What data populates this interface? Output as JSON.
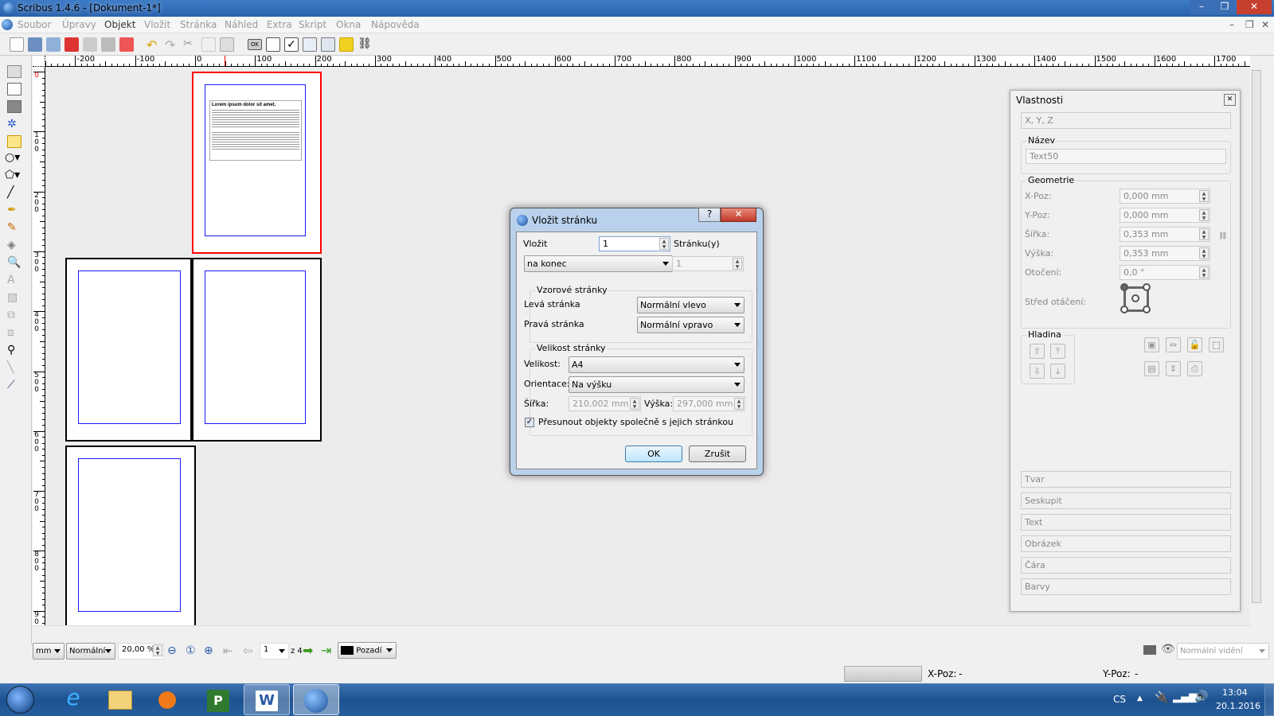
{
  "window": {
    "title": "Scribus 1.4.6 - [Dokument-1*]",
    "controls": [
      "–",
      "❐",
      "✕"
    ],
    "mdi_controls": [
      "–",
      "❐",
      "✕"
    ]
  },
  "menu": [
    "Soubor",
    "Úpravy",
    "Objekt",
    "Vložit",
    "Stránka",
    "Náhled",
    "Extra",
    "Skript",
    "Okna",
    "Nápověda"
  ],
  "toolbar": {
    "icons": [
      "new-document-icon",
      "open-icon",
      "save-icon",
      "close-icon",
      "print-icon",
      "preflight-icon",
      "pdf-export-icon",
      "undo-icon",
      "redo-icon",
      "cut-icon",
      "copy-icon",
      "paste-icon",
      "pdf-button-icon",
      "pdf-text-field-icon",
      "pdf-checkbox-icon",
      "pdf-combobox-icon",
      "pdf-listbox-icon",
      "pdf-annotation-icon",
      "pdf-link-icon"
    ],
    "ok_label": "OK"
  },
  "rulers": {
    "horizontal": [
      "-200",
      "-100",
      "0",
      "100",
      "200",
      "300",
      "400",
      "500",
      "600",
      "700",
      "800",
      "900",
      "1000",
      "1100",
      "1200",
      "1300",
      "1400",
      "1500",
      "1600",
      "1700"
    ],
    "vertical": [
      "0",
      "100",
      "200",
      "300",
      "400",
      "500",
      "600",
      "700",
      "800",
      "900"
    ]
  },
  "page1_text": {
    "heading": "Lorem ipsum dolor sit amet."
  },
  "dialog": {
    "title": "Vložit stránku",
    "help": "?",
    "close": "✕",
    "insert_label": "Vložit",
    "insert_count": "1",
    "pages_label": "Stránku(y)",
    "position": "na konec",
    "position_page": "1",
    "master_group": "Vzorové stránky",
    "left_label": "Levá stránka",
    "left_value": "Normální vlevo",
    "right_label": "Pravá stránka",
    "right_value": "Normální vpravo",
    "size_group": "Velikost stránky",
    "size_label": "Velikost:",
    "size_value": "A4",
    "orient_label": "Orientace:",
    "orient_value": "Na výšku",
    "width_label": "Šířka:",
    "width_value": "210,002 mm",
    "height_label": "Výška:",
    "height_value": "297,000 mm",
    "move_objects_label": "Přesunout objekty společně s jejich stránkou",
    "move_objects_checked": true,
    "ok": "OK",
    "cancel": "Zrušit"
  },
  "properties": {
    "title": "Vlastnosti",
    "xyz": "X, Y, Z",
    "name_group": "Název",
    "name_value": "Text50",
    "geometry_group": "Geometrie",
    "fields": [
      {
        "label": "X-Poz:",
        "value": "0,000 mm"
      },
      {
        "label": "Y-Poz:",
        "value": "0,000 mm"
      },
      {
        "label": "Šířka:",
        "value": "0,353 mm"
      },
      {
        "label": "Výška:",
        "value": "0,353 mm"
      },
      {
        "label": "Otočení:",
        "value": "0,0 °"
      }
    ],
    "rotation_center_label": "Střed otáčení:",
    "layer_group": "Hladina",
    "sections": [
      "Tvar",
      "Seskupit",
      "Text",
      "Obrázek",
      "Čára",
      "Barvy"
    ]
  },
  "statusbar": {
    "unit": "mm",
    "mode": "Normální",
    "zoom": "20,00 %",
    "page": "1",
    "page_of": "z 4",
    "layer": "Pozadí",
    "view_mode": "Normální vidění",
    "xpos_label": "X-Poz:",
    "xpos_value": "-",
    "ypos_label": "Y-Poz:",
    "ypos_value": "-"
  },
  "taskbar": {
    "apps": [
      "internet-explorer",
      "file-explorer",
      "media-player",
      "project",
      "word",
      "scribus"
    ],
    "language": "CS",
    "time": "13:04",
    "date": "20.1.2016"
  },
  "colors": {
    "titlebar": "#2a62ac",
    "page_border_selected": "#ff0000",
    "margin_guides": "#1a1aff",
    "taskbar": "#1e5290"
  }
}
